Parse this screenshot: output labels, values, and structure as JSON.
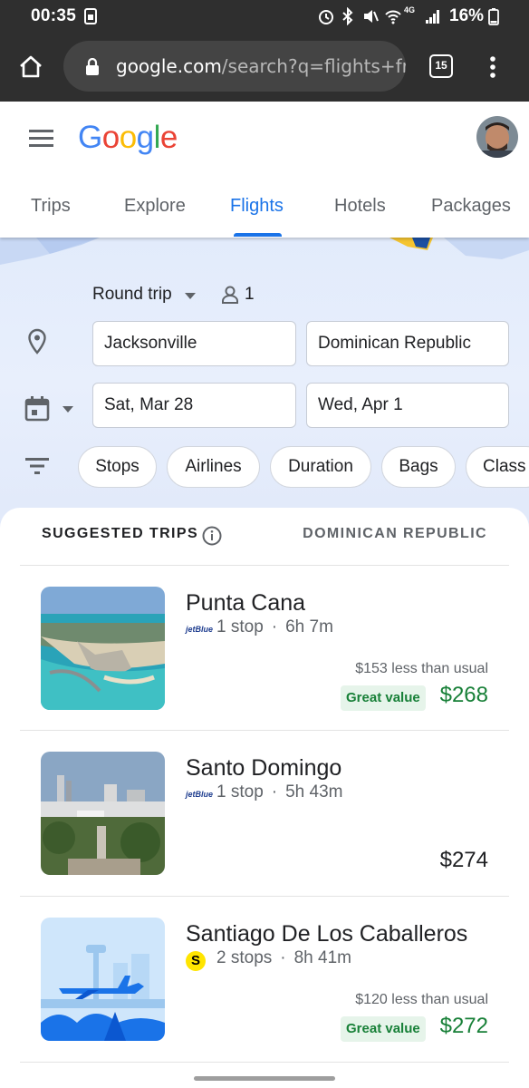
{
  "status_bar": {
    "time": "00:35",
    "battery": "16%",
    "network": "4G"
  },
  "browser": {
    "url_host": "google.com",
    "url_path": "/search?q=flights+from-",
    "tab_count": "15"
  },
  "header": {
    "logo_letters": [
      "G",
      "o",
      "o",
      "g",
      "l",
      "e"
    ],
    "logo_colors": [
      "#4285F4",
      "#EA4335",
      "#FBBC05",
      "#4285F4",
      "#34A853",
      "#EA4335"
    ],
    "tabs": [
      {
        "label": "Trips",
        "active": false
      },
      {
        "label": "Explore",
        "active": false
      },
      {
        "label": "Flights",
        "active": true
      },
      {
        "label": "Hotels",
        "active": false
      },
      {
        "label": "Packages",
        "active": false
      }
    ]
  },
  "search": {
    "trip_type": "Round trip",
    "passengers": "1",
    "origin": "Jacksonville",
    "destination": "Dominican Republic",
    "depart_date": "Sat, Mar 28",
    "return_date": "Wed, Apr 1",
    "filters": [
      "Stops",
      "Airlines",
      "Duration",
      "Bags",
      "Class"
    ]
  },
  "results": {
    "heading": "SUGGESTED TRIPS",
    "region": "DOMINICAN REPUBLIC",
    "trips": [
      {
        "name": "Punta Cana",
        "airline": "jetBlue",
        "stops": "1 stop",
        "duration": "6h 7m",
        "savings": "$153 less than usual",
        "badge": "Great value",
        "price": "$268"
      },
      {
        "name": "Santo Domingo",
        "airline": "jetBlue",
        "stops": "1 stop",
        "duration": "5h 43m",
        "price": "$274"
      },
      {
        "name": "Santiago De Los Caballeros",
        "airline_mark": "S",
        "stops": "2 stops",
        "duration": "8h 41m",
        "savings": "$120 less than usual",
        "badge": "Great value",
        "price": "$272"
      }
    ]
  },
  "colors": {
    "accent": "#1a73e8",
    "deal_green": "#188038",
    "deal_bg": "#e6f4ea"
  }
}
